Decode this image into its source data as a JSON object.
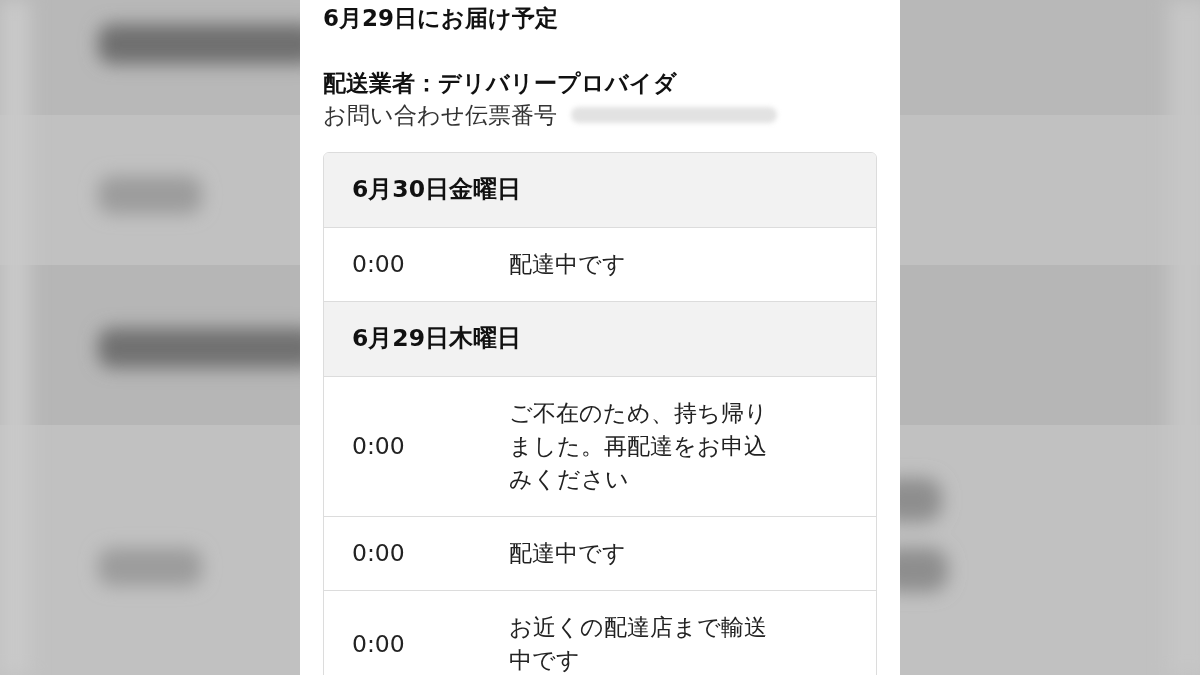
{
  "delivery_estimate": "6月29日にお届け予定",
  "carrier": "配送業者：デリバリープロバイダ",
  "tracking": {
    "label": "お問い合わせ伝票番号"
  },
  "history": [
    {
      "date": "6月30日金曜日",
      "events": [
        {
          "time": "0:00",
          "status": "配達中です"
        }
      ]
    },
    {
      "date": "6月29日木曜日",
      "events": [
        {
          "time": "0:00",
          "status": "ご不在のため、持ち帰りました。再配達をお申込みください"
        },
        {
          "time": "0:00",
          "status": "配達中です"
        },
        {
          "time": "0:00",
          "status": "お近くの配達店まで輸送中です"
        }
      ]
    }
  ]
}
